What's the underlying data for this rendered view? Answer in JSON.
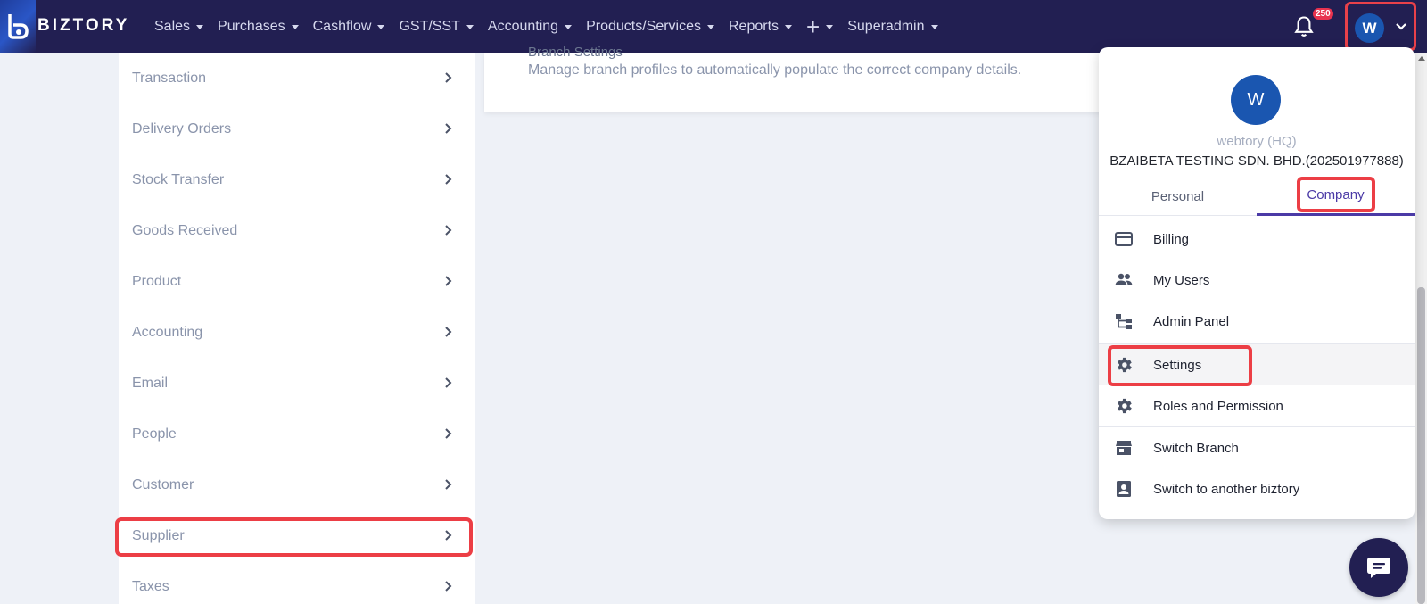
{
  "brand": {
    "name": "BIZTORY"
  },
  "nav": {
    "items": [
      {
        "label": "Sales"
      },
      {
        "label": "Purchases"
      },
      {
        "label": "Cashflow"
      },
      {
        "label": "GST/SST"
      },
      {
        "label": "Accounting"
      },
      {
        "label": "Products/Services"
      },
      {
        "label": "Reports"
      }
    ],
    "superadmin": "Superadmin",
    "notification_count": "250",
    "user_initial": "W"
  },
  "left_menu": {
    "items": [
      {
        "label": "Transaction"
      },
      {
        "label": "Delivery Orders"
      },
      {
        "label": "Stock Transfer"
      },
      {
        "label": "Goods Received"
      },
      {
        "label": "Product"
      },
      {
        "label": "Accounting"
      },
      {
        "label": "Email"
      },
      {
        "label": "People"
      },
      {
        "label": "Customer"
      },
      {
        "label": "Supplier"
      },
      {
        "label": "Taxes"
      }
    ]
  },
  "main": {
    "card_title": "Branch Settings",
    "card_desc": "Manage branch profiles to automatically populate the correct company details."
  },
  "dropdown": {
    "avatar_initial": "W",
    "user_name": "webtory (HQ)",
    "company_name": "BZAIBETA TESTING SDN. BHD.(202501977888)",
    "tabs": {
      "personal": "Personal",
      "company": "Company"
    },
    "items": [
      {
        "label": "Billing",
        "icon": "credit-card-icon"
      },
      {
        "label": "My Users",
        "icon": "users-icon"
      },
      {
        "label": "Admin Panel",
        "icon": "hierarchy-icon"
      },
      {
        "label": "Settings",
        "icon": "gear-icon"
      },
      {
        "label": "Roles and Permission",
        "icon": "gear-icon"
      },
      {
        "label": "Switch Branch",
        "icon": "store-icon"
      },
      {
        "label": "Switch to another biztory",
        "icon": "contact-card-icon"
      }
    ]
  },
  "colors": {
    "topbar": "#221f52",
    "highlight": "#ec3e45",
    "accent": "#4b3aa6",
    "avatar": "#1a56b0"
  }
}
